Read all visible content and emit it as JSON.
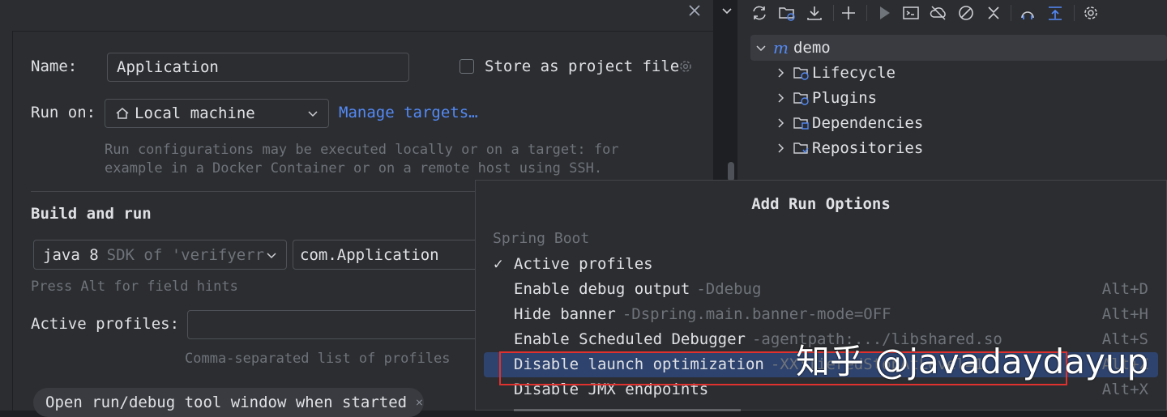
{
  "dialog": {
    "name_label": "Name:",
    "name_value": "Application",
    "store_label": "Store as project file",
    "run_on_label": "Run on:",
    "run_on_value": "Local machine",
    "manage_targets": "Manage targets…",
    "run_on_hint_1": "Run configurations may be executed locally or on a target: for",
    "run_on_hint_2": "example in a Docker Container or on a remote host using SSH.",
    "build_section": "Build and run",
    "jdk_name": "java 8",
    "jdk_detail": "SDK of 'verifyerr",
    "main_class": "com.Application",
    "field_hints": "Press Alt for field hints",
    "profiles_label": "Active profiles:",
    "profiles_hint": "Comma-separated list of profiles",
    "tag_open_window": "Open run/debug tool window when started"
  },
  "maven_tree": {
    "root": "demo",
    "root_icon_letter": "m",
    "items": [
      {
        "label": "Lifecycle"
      },
      {
        "label": "Plugins"
      },
      {
        "label": "Dependencies"
      },
      {
        "label": "Repositories"
      }
    ]
  },
  "popup": {
    "title": "Add Run Options",
    "group": "Spring Boot",
    "items": [
      {
        "name": "Active profiles",
        "option": "",
        "shortcut": "",
        "checked": true
      },
      {
        "name": "Enable debug output",
        "option": "-Ddebug",
        "shortcut": "Alt+D"
      },
      {
        "name": "Hide banner",
        "option": "-Dspring.main.banner-mode=OFF",
        "shortcut": "Alt+H"
      },
      {
        "name": "Enable Scheduled Debugger",
        "option": "-agentpath:.../libshared.so",
        "shortcut": "Alt+S"
      },
      {
        "name": "Disable launch optimization",
        "option": "-XX:TieredStopAtLevel=1",
        "shortcut": "Alt+Z"
      },
      {
        "name": "Disable JMX endpoints",
        "option": "",
        "shortcut": "Alt+X"
      }
    ]
  },
  "watermark": "知乎 @javadaydayup",
  "colors": {
    "accent": "#548af7",
    "selection": "#2e436e",
    "highlight_box": "#e0312f"
  }
}
